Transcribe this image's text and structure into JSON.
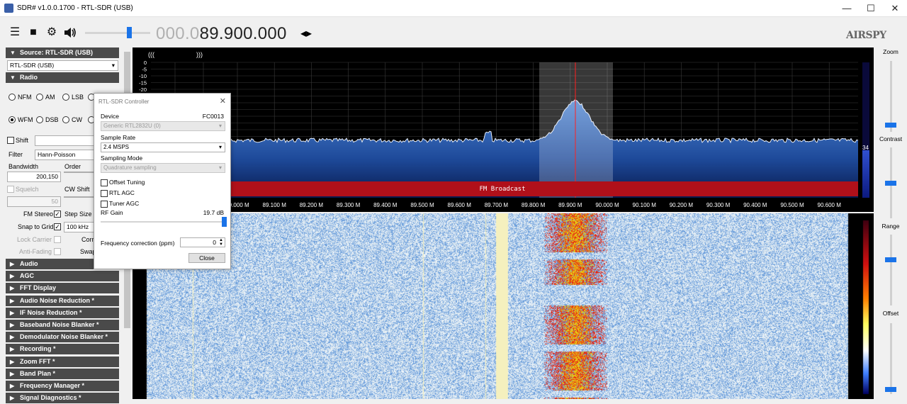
{
  "window": {
    "title": "SDR# v1.0.0.1700 - RTL-SDR (USB)",
    "controls": [
      "—",
      "☐",
      "✕"
    ]
  },
  "toolbar": {
    "frequency_dim": "000.0",
    "frequency_bright": "89.900.000",
    "logo": "AIRSPY",
    "volume_level": 0.65
  },
  "sidebar": {
    "source_header": "Source: RTL-SDR (USB)",
    "source_select": "RTL-SDR (USB)",
    "radio_header": "Radio",
    "modes_row1": [
      "NFM",
      "AM",
      "LSB"
    ],
    "modes_row2": [
      "WFM",
      "DSB",
      "CW"
    ],
    "selected_mode": "WFM",
    "shift_label": "Shift",
    "filter_label": "Filter",
    "filter_value": "Hann-Poisson",
    "bandwidth_label": "Bandwidth",
    "bandwidth_value": "200,150",
    "order_label": "Order",
    "squelch_label": "Squelch",
    "squelch_value": "50",
    "cw_shift_label": "CW Shift",
    "fm_stereo_label": "FM Stereo",
    "step_size_label": "Step Size",
    "step_size_value": "100 kHz",
    "snap_to_grid_label": "Snap to Grid",
    "lock_carrier_label": "Lock Carrier",
    "corr_label": "Corr",
    "anti_fading_label": "Anti-Fading",
    "swap_label": "Swap",
    "sections": [
      "Audio",
      "AGC",
      "FFT Display",
      "Audio Noise Reduction *",
      "IF Noise Reduction *",
      "Baseband Noise Blanker *",
      "Demodulator Noise Blanker *",
      "Recording *",
      "Zoom FFT *",
      "Band Plan *",
      "Frequency Manager *",
      "Signal Diagnostics *"
    ]
  },
  "dialog": {
    "title": "RTL-SDR Controller",
    "device_label": "Device",
    "device_chip": "FC0013",
    "device_value": "Generic RTL2832U (0)",
    "sample_rate_label": "Sample Rate",
    "sample_rate_value": "2.4 MSPS",
    "sampling_mode_label": "Sampling Mode",
    "sampling_mode_value": "Quadrature sampling",
    "offset_tuning_label": "Offset Tuning",
    "rtl_agc_label": "RTL AGC",
    "tuner_agc_label": "Tuner AGC",
    "rf_gain_label": "RF Gain",
    "rf_gain_value": "19.7 dB",
    "freq_corr_label": "Frequency correction (ppm)",
    "freq_corr_value": "0",
    "close_label": "Close"
  },
  "spectrum": {
    "y_ticks": [
      "0",
      "-5",
      "-10",
      "-15",
      "-20"
    ],
    "x_ticks": [
      "89.000 M",
      "89.100 M",
      "89.200 M",
      "89.300 M",
      "89.400 M",
      "89.500 M",
      "89.600 M",
      "89.700 M",
      "89.800 M",
      "89.900 M",
      "90.000 M",
      "90.100 M",
      "90.200 M",
      "90.300 M",
      "90.400 M",
      "90.500 M",
      "90.600 M"
    ],
    "band_label": "FM Broadcast",
    "level_readout": "34",
    "stereo_left": "(((",
    "stereo_right": ")))"
  },
  "right_panel": {
    "labels": [
      "Zoom",
      "Contrast",
      "Range",
      "Offset"
    ]
  },
  "colors": {
    "accent": "#1a73e8",
    "band_red": "#b0101a",
    "spectrum_fill_top": "#4a7ec8",
    "spectrum_fill_bottom": "#0b1e55",
    "tuned_line": "#ff2020"
  }
}
